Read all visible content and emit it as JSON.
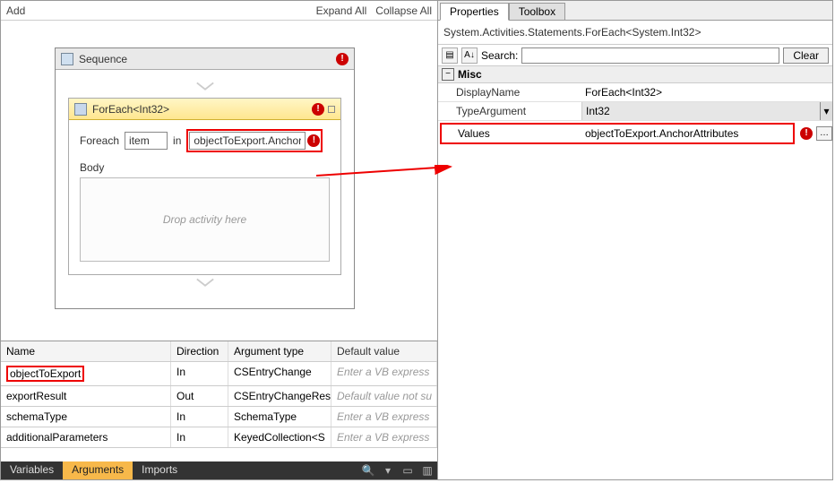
{
  "left": {
    "add": "Add",
    "expand_all": "Expand All",
    "collapse_all": "Collapse All",
    "sequence_title": "Sequence",
    "foreach_title": "ForEach<Int32>",
    "foreach_label": "Foreach",
    "item_value": "item",
    "in_label": "in",
    "in_value": "objectToExport.Anchor",
    "body_label": "Body",
    "drop_hint": "Drop activity here"
  },
  "args": {
    "cols": {
      "name": "Name",
      "dir": "Direction",
      "type": "Argument type",
      "def": "Default value"
    },
    "rows": [
      {
        "name": "objectToExport",
        "dir": "In",
        "type": "CSEntryChange",
        "def": "Enter a VB express",
        "placeholder": true,
        "highlight": true
      },
      {
        "name": "exportResult",
        "dir": "Out",
        "type": "CSEntryChangeRes",
        "def": "Default value not su",
        "placeholder": true,
        "highlight": false
      },
      {
        "name": "schemaType",
        "dir": "In",
        "type": "SchemaType",
        "def": "Enter a VB express",
        "placeholder": true,
        "highlight": false
      },
      {
        "name": "additionalParameters",
        "dir": "In",
        "type": "KeyedCollection<S",
        "def": "Enter a VB express",
        "placeholder": true,
        "highlight": false
      }
    ]
  },
  "bottom_tabs": {
    "variables": "Variables",
    "arguments": "Arguments",
    "imports": "Imports"
  },
  "right": {
    "tabs": {
      "properties": "Properties",
      "toolbox": "Toolbox"
    },
    "object": "System.Activities.Statements.ForEach<System.Int32>",
    "search_label": "Search:",
    "clear": "Clear",
    "cat": "Misc",
    "rows": {
      "display_name": {
        "label": "DisplayName",
        "value": "ForEach<Int32>"
      },
      "type_arg": {
        "label": "TypeArgument",
        "value": "Int32"
      },
      "values": {
        "label": "Values",
        "value": "objectToExport.AnchorAttributes"
      }
    }
  }
}
